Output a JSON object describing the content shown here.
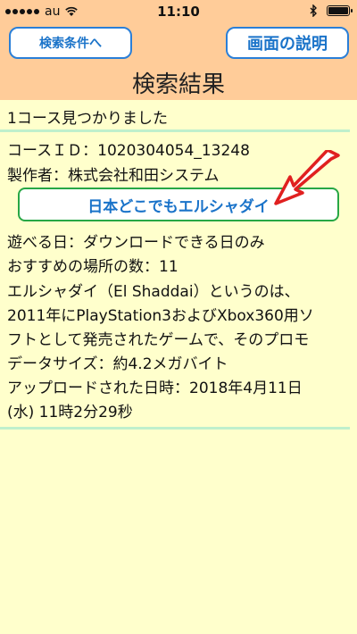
{
  "status_bar": {
    "carrier": "au",
    "time": "11:10",
    "icons": [
      "signal-dots-icon",
      "wifi-icon",
      "bluetooth-icon",
      "battery-icon"
    ]
  },
  "header": {
    "back_button": "検索条件へ",
    "help_button": "画面の説明",
    "title": "検索結果"
  },
  "results": {
    "found_text": "1コース見つかりました",
    "course_id": "コースＩＤ：1020304054_13248",
    "creator": "製作者：株式会社和田システム",
    "course_name": "日本どこでもエルシャダイ",
    "play_days": "遊べる日：ダウンロードできる日のみ",
    "spot_count": "おすすめの場所の数：11",
    "description_lines": [
      "エルシャダイ（El Shaddai）というのは、",
      "2011年にPlayStation3およびXbox360用ソ",
      "フトとして発売されたゲームで、そのプロモ"
    ],
    "data_size": "データサイズ：約4.2メガバイト",
    "uploaded_line1": "アップロードされた日時：2018年4月11日",
    "uploaded_line2": "(水) 11時2分29秒"
  },
  "colors": {
    "header_bg": "#FFCC99",
    "content_bg": "#FFFFCC",
    "button_blue": "#1a73c9",
    "course_border": "#27a745",
    "divider": "#BFF0CC",
    "arrow_red": "#E02020"
  }
}
